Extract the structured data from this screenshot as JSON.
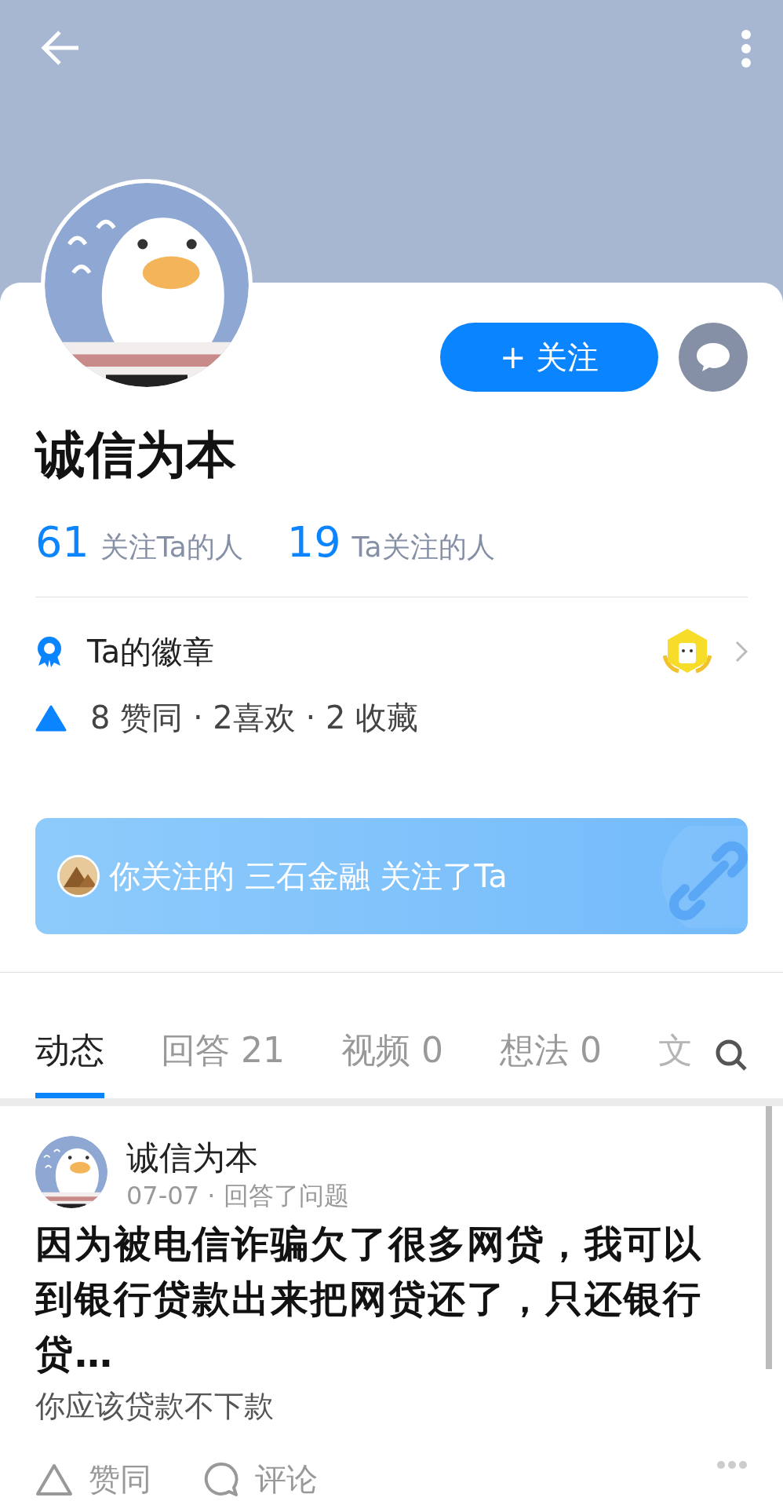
{
  "profile": {
    "name": "诚信为本",
    "follow_button": "+ 关注"
  },
  "stats": [
    {
      "count": "61",
      "label": "关注Ta的人"
    },
    {
      "count": "19",
      "label": "Ta关注的人"
    }
  ],
  "badges": {
    "label": "Ta的徽章"
  },
  "achievements": {
    "text": "8 赞同 · 2喜欢 · 2 收藏"
  },
  "mutual_follow": {
    "text": "你关注的 三石金融 关注了Ta"
  },
  "tabs": [
    {
      "label": "动态",
      "selected": true
    },
    {
      "label": "回答 21",
      "selected": false
    },
    {
      "label": "视频 0",
      "selected": false
    },
    {
      "label": "想法 0",
      "selected": false
    },
    {
      "label": "文",
      "selected": false
    }
  ],
  "post": {
    "author": "诚信为本",
    "meta": "07-07 · 回答了问题",
    "title": "因为被电信诈骗欠了很多网贷，我可以到银行贷款出来把网贷还了，只还银行贷…",
    "excerpt": "你应该贷款不下款",
    "actions": [
      {
        "kind": "like",
        "label": "赞同"
      },
      {
        "kind": "comment",
        "label": "评论"
      }
    ]
  }
}
